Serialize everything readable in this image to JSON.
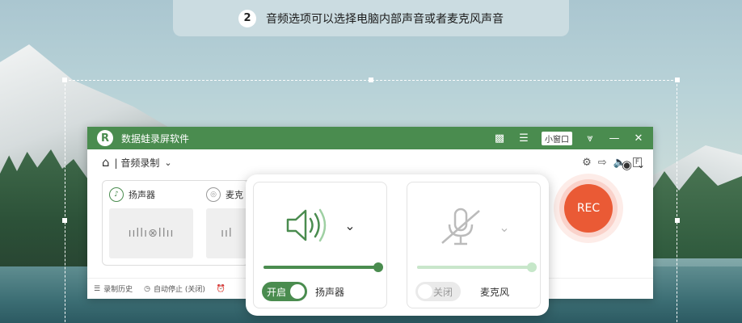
{
  "tip": {
    "number": "2",
    "text": "音频选项可以选择电脑内部声音或者麦克风声音"
  },
  "app": {
    "title": "数据蛙录屏软件",
    "logo_letter": "R",
    "mini_window_label": "小窗口",
    "mode_label": "| 音频录制",
    "rec_label": "REC"
  },
  "sources": {
    "speaker_label": "扬声器",
    "mic_label": "麦克"
  },
  "bottom_bar": {
    "history_label": "录制历史",
    "auto_stop_label": "自动停止 (关闭)"
  },
  "audio_popup": {
    "speaker": {
      "toggle_label": "开启",
      "device_label": "扬声器",
      "volume": 1.0,
      "enabled": true
    },
    "mic": {
      "toggle_label": "关闭",
      "device_label": "麦克风",
      "volume": 1.0,
      "enabled": false
    }
  },
  "colors": {
    "brand": "#4a8c4f",
    "rec": "#ea5a35"
  },
  "icons": [
    "home-icon",
    "settings-icon",
    "export-icon",
    "speaker-icon",
    "fn-icon",
    "camera-icon",
    "message-icon",
    "menu-icon",
    "pin-icon",
    "minimize-icon",
    "close-icon",
    "microphone-muted-icon",
    "list-icon",
    "clock-icon",
    "alarm-icon"
  ]
}
